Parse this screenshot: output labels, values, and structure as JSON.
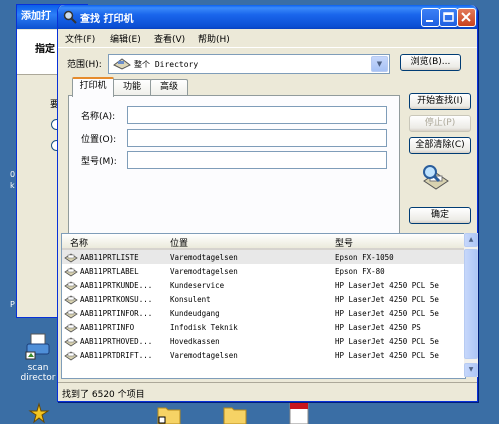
{
  "desktop": {
    "bg_window_title": "添加打",
    "bg_window_heading": "指定",
    "bg_window_label": "要",
    "left_edge_texts": [
      "0",
      "k",
      "P"
    ],
    "icons": [
      {
        "label_line1": "scan",
        "label_line2": "director",
        "icon": "scan-director-icon"
      }
    ]
  },
  "window": {
    "title": "查找 打印机",
    "menu": [
      "文件(F)",
      "编辑(E)",
      "查看(V)",
      "帮助(H)"
    ],
    "scope_label": "范围(H):",
    "scope_value": "整个 Directory",
    "browse_button": "浏览(B)...",
    "tabs": [
      "打印机",
      "功能",
      "高级"
    ],
    "selected_tab": "打印机",
    "fields": [
      {
        "label": "名称(A):",
        "value": ""
      },
      {
        "label": "位置(O):",
        "value": ""
      },
      {
        "label": "型号(M):",
        "value": ""
      }
    ],
    "buttons": {
      "find_now": "开始查找(I)",
      "stop": "停止(P)",
      "clear_all": "全部清除(C)",
      "ok": "确定"
    },
    "columns": [
      "名称",
      "位置",
      "型号"
    ],
    "rows": [
      {
        "name": "AAB11PRTLISTE",
        "location": "Varemodtagelsen",
        "model": "Epson FX-1050"
      },
      {
        "name": "AAB11PRTLABEL",
        "location": "Varemodtagelsen",
        "model": "Epson FX-80"
      },
      {
        "name": "AAB11PRTKUNDE...",
        "location": "Kundeservice",
        "model": "HP LaserJet 4250 PCL 5e"
      },
      {
        "name": "AAB11PRTKONSU...",
        "location": "Konsulent",
        "model": "HP LaserJet 4250 PCL 5e"
      },
      {
        "name": "AAB11PRTINFOR...",
        "location": "Kundeudgang",
        "model": "HP LaserJet 4250 PCL 5e"
      },
      {
        "name": "AAB11PRTINFO",
        "location": "Infodisk Teknik",
        "model": "HP LaserJet 4250 PS"
      },
      {
        "name": "AAB11PRTHOVED...",
        "location": "Hovedkassen",
        "model": "HP LaserJet 4250 PCL 5e"
      },
      {
        "name": "AAB11PRTDRIFT...",
        "location": "Varemodtagelsen",
        "model": "HP LaserJet 4250 PCL 5e"
      }
    ],
    "status": "找到了 6520 个项目"
  },
  "colors": {
    "desktop": "#3a6ea5",
    "titlebar": "#0b4fd3",
    "window_bg": "#ece9d8",
    "tab_accent": "#e68b2c"
  }
}
